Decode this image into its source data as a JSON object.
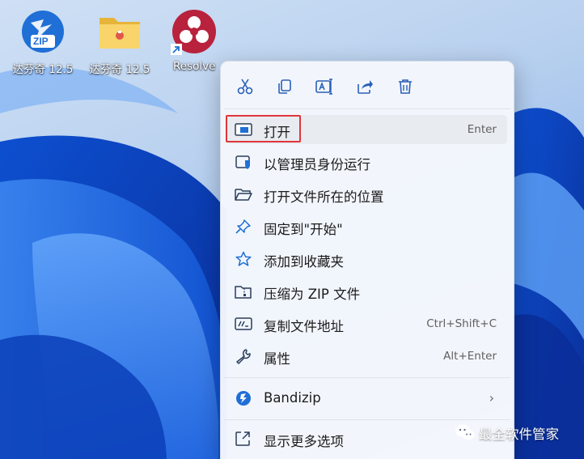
{
  "desktop": {
    "icons": [
      {
        "label": "达芬奇 12.5",
        "icon": "zip-archive-icon"
      },
      {
        "label": "达芬奇 12.5",
        "icon": "folder-icon"
      },
      {
        "label": "Resolve",
        "icon": "davinci-resolve-icon"
      }
    ],
    "zip_badge": "ZIP"
  },
  "context_menu": {
    "quick_actions": [
      {
        "name": "cut",
        "icon": "scissors-icon"
      },
      {
        "name": "copy",
        "icon": "copy-icon"
      },
      {
        "name": "rename",
        "icon": "rename-icon"
      },
      {
        "name": "share",
        "icon": "share-icon"
      },
      {
        "name": "delete",
        "icon": "trash-icon"
      }
    ],
    "items": [
      {
        "label": "打开",
        "shortcut": "Enter",
        "icon": "window-icon"
      },
      {
        "label": "以管理员身份运行",
        "shortcut": "",
        "icon": "shield-icon"
      },
      {
        "label": "打开文件所在的位置",
        "shortcut": "",
        "icon": "folder-open-icon"
      },
      {
        "label": "固定到\"开始\"",
        "shortcut": "",
        "icon": "pin-icon"
      },
      {
        "label": "添加到收藏夹",
        "shortcut": "",
        "icon": "star-icon"
      },
      {
        "label": "压缩为 ZIP 文件",
        "shortcut": "",
        "icon": "zip-folder-icon"
      },
      {
        "label": "复制文件地址",
        "shortcut": "Ctrl+Shift+C",
        "icon": "path-icon"
      },
      {
        "label": "属性",
        "shortcut": "Alt+Enter",
        "icon": "wrench-icon"
      },
      {
        "label": "Bandizip",
        "shortcut": "",
        "icon": "bandizip-icon"
      },
      {
        "label": "显示更多选项",
        "shortcut": "",
        "icon": "more-options-icon"
      }
    ]
  },
  "watermark": {
    "text": "最全软件管家",
    "icon": "wechat-icon"
  },
  "colors": {
    "accent_blue": "#1f6fd6",
    "highlight_box": "#e0353b",
    "menu_bg": "#f4f7fc"
  }
}
